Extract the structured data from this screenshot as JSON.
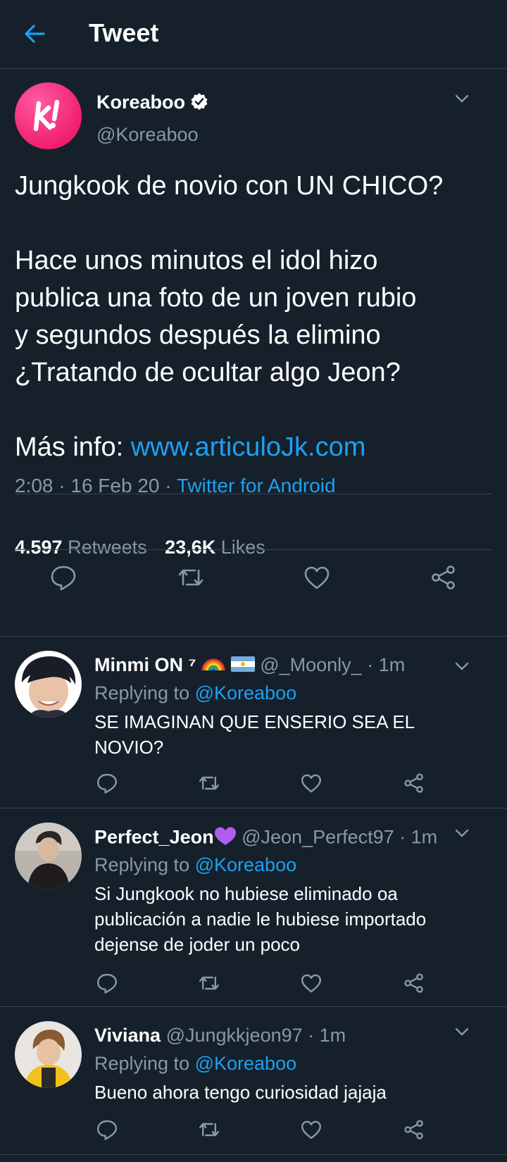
{
  "header": {
    "title": "Tweet"
  },
  "tweet": {
    "author_name": "Koreaboo",
    "author_handle": "@Koreaboo",
    "paragraph1": "Jungkook de novio con UN CHICO?",
    "paragraph2_lines": [
      "Hace unos minutos el idol hizo",
      "publica una foto de un joven rubio",
      "y segundos después la elimino",
      "¿Tratando de ocultar algo Jeon?"
    ],
    "more_info_label": "Más info: ",
    "more_info_link": "www.articuloJk.com",
    "time": "2:08 · 16 Feb 20 · ",
    "source": "Twitter for Android",
    "retweets_count": "4.597",
    "retweets_label": "Retweets",
    "likes_count": "23,6K",
    "likes_label": "Likes"
  },
  "replies": [
    {
      "name": "Minmi ON ⁷",
      "handle": "@_Moonly_",
      "time": "· 1m",
      "replying_label": "Replying to ",
      "mention": "@Koreaboo",
      "text_lines": [
        "SE IMAGINAN QUE ENSERIO SEA EL",
        "NOVIO?"
      ]
    },
    {
      "name": "Perfect_Jeon",
      "handle": "@Jeon_Perfect97",
      "time": "· 1m",
      "replying_label": "Replying to ",
      "mention": "@Koreaboo",
      "text_lines": [
        "Si Jungkook no hubiese eliminado oa",
        "publicación a nadie le hubiese importado",
        "dejense de joder un poco"
      ]
    },
    {
      "name": "Viviana",
      "handle": "@Jungkkjeon97",
      "time": "· 1m",
      "replying_label": "Replying to ",
      "mention": "@Koreaboo",
      "text_lines": [
        "Bueno ahora tengo curiosidad jajaja"
      ]
    }
  ],
  "icons": [
    "back-arrow-icon",
    "verified-badge-icon",
    "chevron-down-icon",
    "reply-icon",
    "retweet-icon",
    "like-icon",
    "share-icon",
    "rainbow-emoji-icon",
    "argentina-flag-icon",
    "purple-heart-icon"
  ],
  "colors": {
    "background": "#15202b",
    "accent": "#1da1f2",
    "muted": "#8899a6",
    "brand_pink": "#f1206d"
  }
}
